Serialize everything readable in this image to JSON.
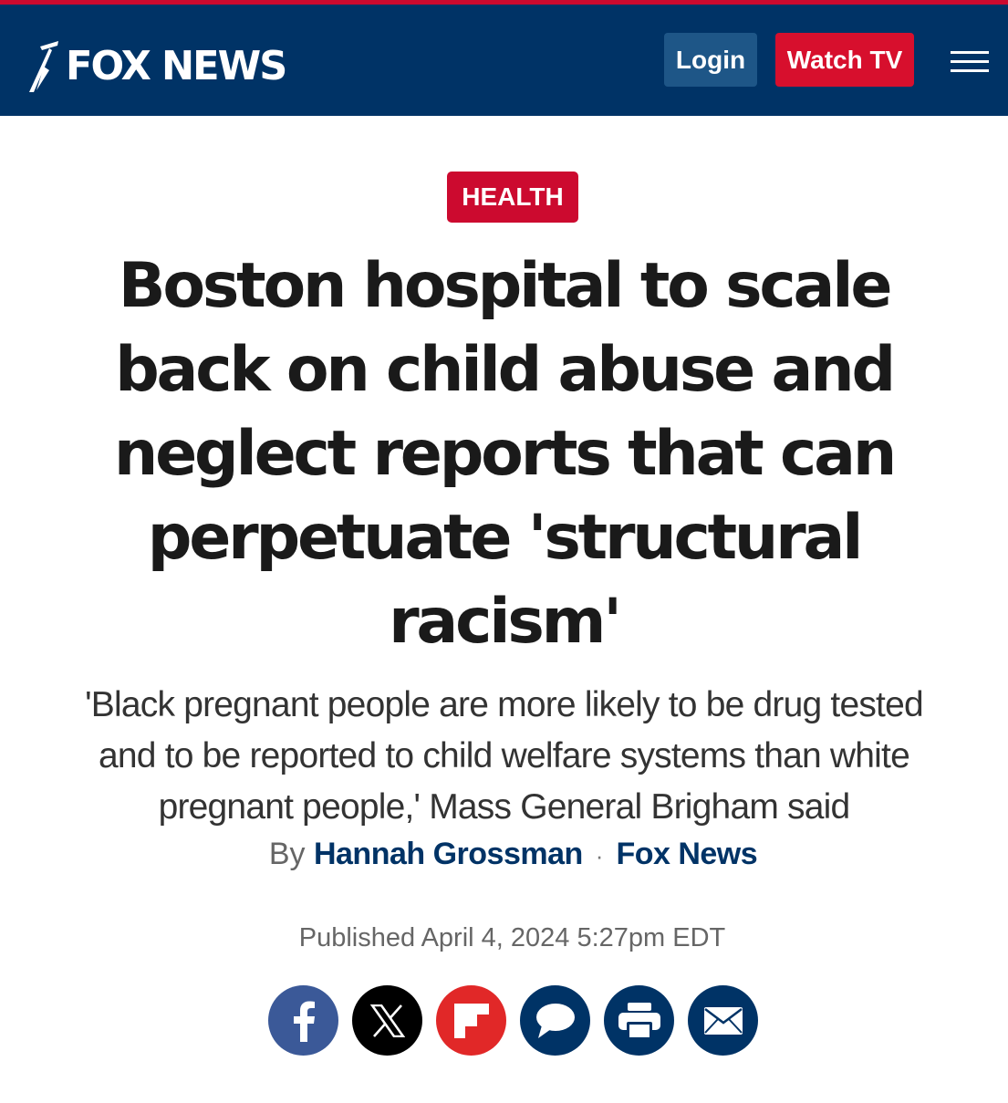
{
  "header": {
    "logo_text": "FOX NEWS",
    "login_label": "Login",
    "watch_label": "Watch TV"
  },
  "article": {
    "category": "HEALTH",
    "headline_lines": [
      "Boston hospital to scale",
      "back on child abuse and",
      "neglect reports that can",
      "perpetuate 'structural",
      "racism'"
    ],
    "subhead_lines": [
      "'Black pregnant people are more likely to be drug tested",
      "and to be reported to child welfare systems than white",
      "pregnant people,' Mass General Brigham said"
    ],
    "byline_prefix": "By",
    "author": "Hannah Grossman",
    "separator": "·",
    "source": "Fox News",
    "published": "Published April 4, 2024 5:27pm EDT"
  },
  "share": [
    {
      "icon": "facebook-icon",
      "color": "#3b5998"
    },
    {
      "icon": "x-icon",
      "color": "#000000"
    },
    {
      "icon": "flipboard-icon",
      "color": "#e12828"
    },
    {
      "icon": "comment-icon",
      "color": "#003366"
    },
    {
      "icon": "print-icon",
      "color": "#003366"
    },
    {
      "icon": "email-icon",
      "color": "#003366"
    }
  ],
  "colors": {
    "header_bg": "#003366",
    "accent_red": "#cc0a2f",
    "link_blue": "#003366"
  }
}
